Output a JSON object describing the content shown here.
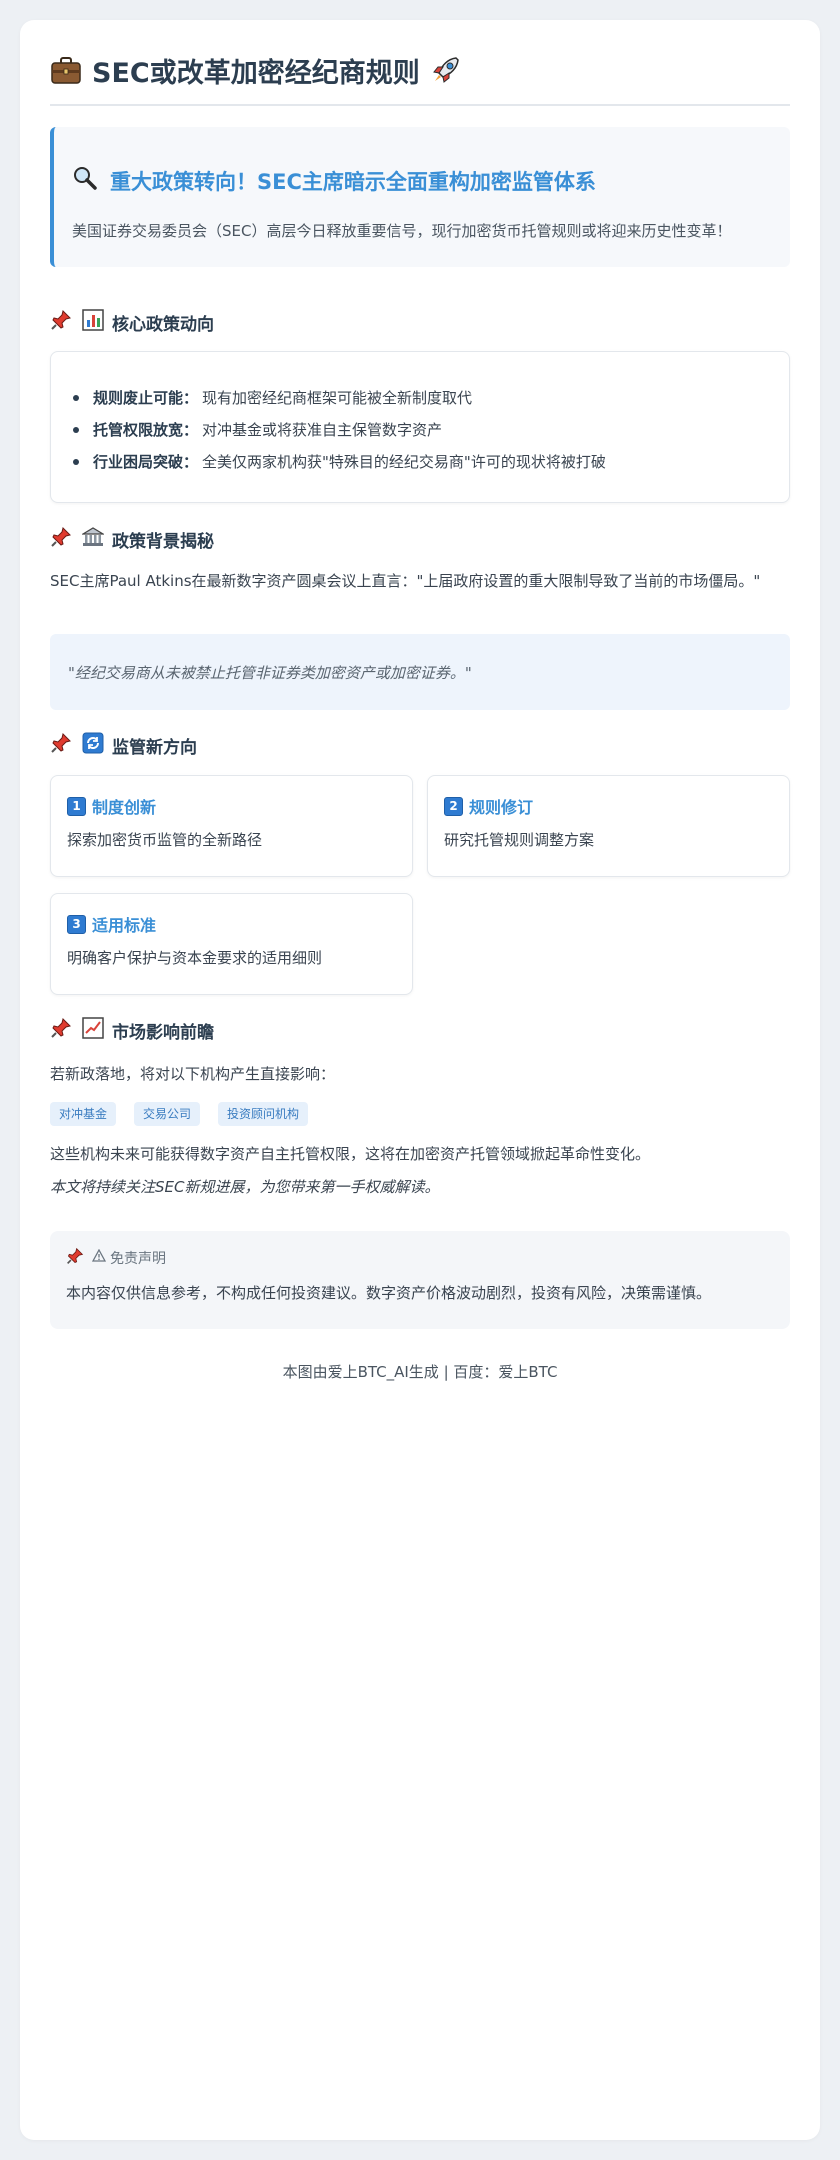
{
  "header": {
    "title": "SEC或改革加密经纪商规则",
    "left_icon": "briefcase-icon",
    "right_icon": "rocket-icon"
  },
  "hero": {
    "icon": "magnifier-icon",
    "title": "重大政策转向！SEC主席暗示全面重构加密监管体系",
    "subtitle": "美国证券交易委员会（SEC）高层今日释放重要信号，现行加密货币托管规则或将迎来历史性变革！"
  },
  "sections": {
    "core": {
      "title": "核心政策动向",
      "icon": "bar-chart-icon",
      "items": [
        {
          "label": "规则废止可能：",
          "text": "现有加密经纪商框架可能被全新制度取代"
        },
        {
          "label": "托管权限放宽：",
          "text": "对冲基金或将获准自主保管数字资产"
        },
        {
          "label": "行业困局突破：",
          "text": "全美仅两家机构获\"特殊目的经纪交易商\"许可的现状将被打破"
        }
      ]
    },
    "background": {
      "title": "政策背景揭秘",
      "icon": "bank-icon",
      "paragraph": "SEC主席Paul Atkins在最新数字资产圆桌会议上直言：\"上届政府设置的重大限制导致了当前的市场僵局。\"",
      "quote": "\"经纪交易商从未被禁止托管非证券类加密资产或加密证券。\""
    },
    "direction": {
      "title": "监管新方向",
      "icon": "refresh-icon",
      "cards": [
        {
          "num": "1",
          "title": "制度创新",
          "body": "探索加密货币监管的全新路径"
        },
        {
          "num": "2",
          "title": "规则修订",
          "body": "研究托管规则调整方案"
        },
        {
          "num": "3",
          "title": "适用标准",
          "body": "明确客户保护与资本金要求的适用细则"
        }
      ]
    },
    "impact": {
      "title": "市场影响前瞻",
      "icon": "trend-chart-icon",
      "intro": "若新政落地，将对以下机构产生直接影响：",
      "tags": [
        "对冲基金",
        "交易公司",
        "投资顾问机构"
      ],
      "paragraph": "这些机构未来可能获得数字资产自主托管权限，这将在加密资产托管领域掀起革命性变化。",
      "note": "本文将持续关注SEC新规进展，为您带来第一手权威解读。"
    }
  },
  "disclaimer": {
    "title": "免责声明",
    "body": "本内容仅供信息参考，不构成任何投资建议。数字资产价格波动剧烈，投资有风险，决策需谨慎。"
  },
  "footer": "本图由爱上BTC_AI生成 | 百度：爱上BTC",
  "colors": {
    "accent": "#3a8fd6",
    "heading": "#2c3e50",
    "pin": "#e03b2f"
  }
}
